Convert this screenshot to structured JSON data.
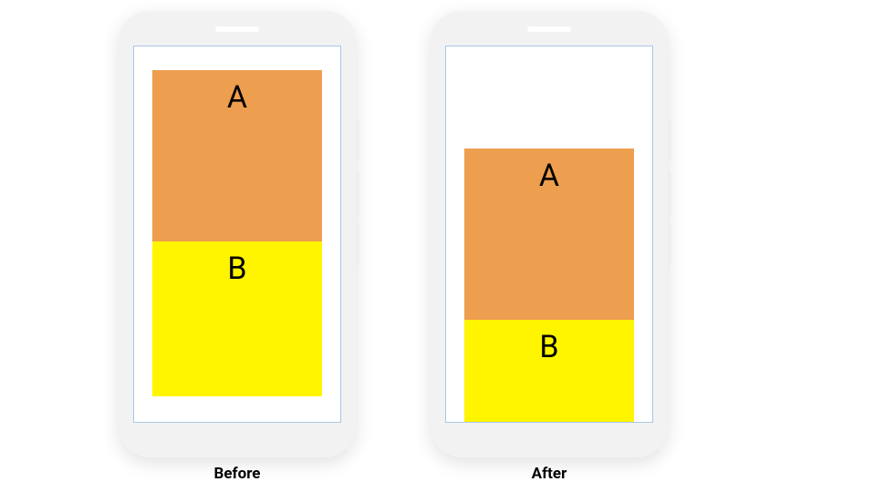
{
  "diagram": {
    "purpose": "layout-shift-illustration",
    "states": [
      {
        "key": "before",
        "caption": "Before",
        "blocks": [
          {
            "id": "A",
            "label": "A",
            "color": "#ee9e4f"
          },
          {
            "id": "B",
            "label": "B",
            "color": "#fff500"
          }
        ]
      },
      {
        "key": "after",
        "caption": "After",
        "blocks": [
          {
            "id": "A",
            "label": "A",
            "color": "#ee9e4f"
          },
          {
            "id": "B",
            "label": "B",
            "color": "#fff500"
          }
        ]
      }
    ]
  }
}
